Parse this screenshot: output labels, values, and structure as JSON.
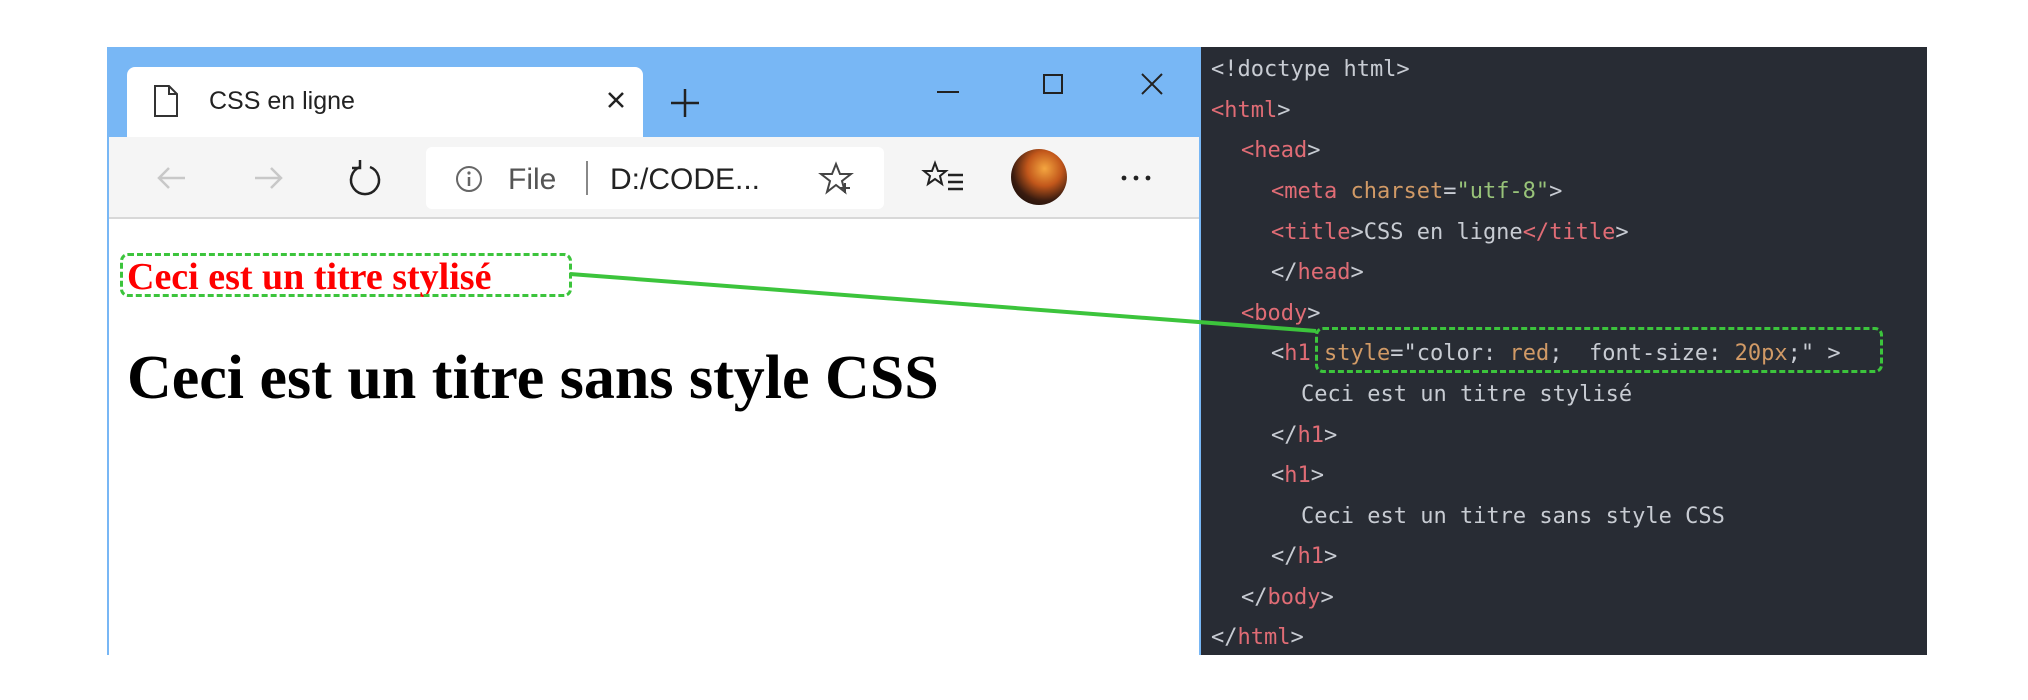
{
  "browser": {
    "tab": {
      "title": "CSS en ligne"
    },
    "address": {
      "scheme": "File",
      "url": "D:/CODE..."
    },
    "accent_color": "#78b7f5",
    "icons": [
      "page-icon",
      "close-icon",
      "plus-icon",
      "minimize-icon",
      "maximize-icon",
      "close-icon",
      "back-icon",
      "forward-icon",
      "refresh-icon",
      "info-icon",
      "favorite-star-icon",
      "favorites-list-icon",
      "avatar",
      "more-icon"
    ]
  },
  "page": {
    "styled_heading": "Ceci est un titre stylisé",
    "plain_heading": "Ceci est un titre sans style CSS",
    "styled_heading_color": "#ff0000"
  },
  "code": {
    "doctype": "<!doctype html>",
    "html_open": "html",
    "head_open": "head",
    "meta_tag": "meta",
    "meta_attr": "charset",
    "meta_value": "\"utf-8\"",
    "title_tag": "title",
    "title_text": "CSS en ligne",
    "head_close": "head",
    "body_open": "body",
    "h1_tag": "h1",
    "style_attr": "style",
    "style_prop1": "color:",
    "style_val1": "red",
    "style_prop2": "font-size:",
    "style_val2": "20px",
    "h1_text_1": "Ceci est un titre stylisé",
    "h1_text_2": "Ceci est un titre sans style CSS",
    "body_close": "body",
    "html_close": "html"
  },
  "annotation": {
    "highlight_color": "#3cc43c"
  }
}
